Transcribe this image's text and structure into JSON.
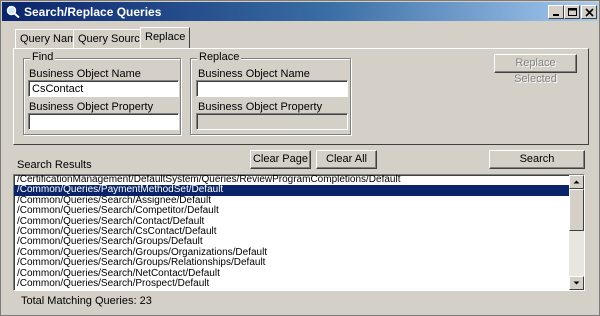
{
  "window": {
    "title": "Search/Replace Queries"
  },
  "tabs": [
    {
      "label": "Query Name",
      "active": false
    },
    {
      "label": "Query Sources",
      "active": false
    },
    {
      "label": "Replace",
      "active": true
    }
  ],
  "find": {
    "group_label": "Find",
    "bo_name_label": "Business Object Name",
    "bo_name_value": "CsContact",
    "bo_prop_label": "Business Object Property",
    "bo_prop_value": ""
  },
  "replace": {
    "group_label": "Replace",
    "bo_name_label": "Business Object Name",
    "bo_name_value": "",
    "bo_prop_label": "Business Object Property",
    "bo_prop_value": ""
  },
  "buttons": {
    "replace_selected": "Replace Selected",
    "clear_page": "Clear Page",
    "clear_all": "Clear All",
    "search": "Search"
  },
  "results": {
    "label": "Search Results",
    "items": [
      "/CertificationManagement/DefaultSystem/Queries/ReviewProgramCompletions/Default",
      "/Common/Queries/PaymentMethodSet/Default",
      "/Common/Queries/Search/Assignee/Default",
      "/Common/Queries/Search/Competitor/Default",
      "/Common/Queries/Search/Contact/Default",
      "/Common/Queries/Search/CsContact/Default",
      "/Common/Queries/Search/Groups/Default",
      "/Common/Queries/Search/Groups/Organizations/Default",
      "/Common/Queries/Search/Groups/Relationships/Default",
      "/Common/Queries/Search/NetContact/Default",
      "/Common/Queries/Search/Prospect/Default"
    ],
    "selected_index": 1,
    "total_text": "Total Matching Queries: 23"
  }
}
